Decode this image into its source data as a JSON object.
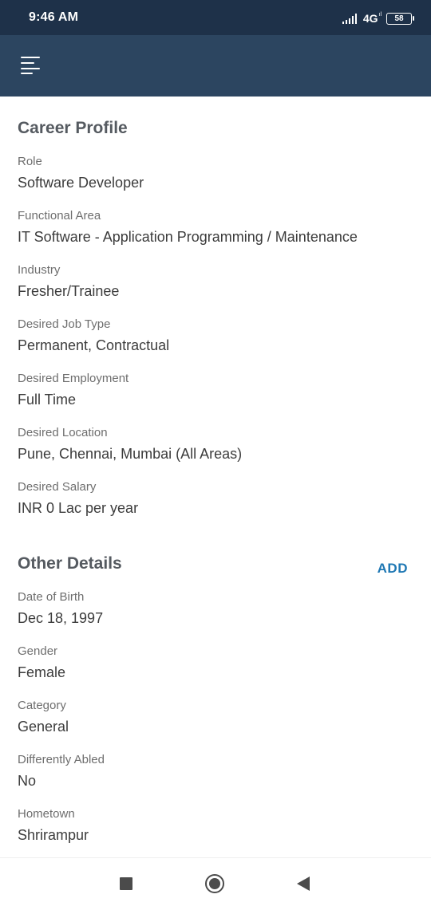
{
  "status_bar": {
    "time": "9:46 AM",
    "network": "4G",
    "battery": "58"
  },
  "app_bar": {
    "menu_icon": "hamburger-menu-icon"
  },
  "career_profile": {
    "title": "Career Profile",
    "fields": [
      {
        "label": "Role",
        "value": "Software Developer"
      },
      {
        "label": "Functional Area",
        "value": "IT Software - Application Programming / Maintenance"
      },
      {
        "label": "Industry",
        "value": "Fresher/Trainee"
      },
      {
        "label": "Desired Job Type",
        "value": "Permanent, Contractual"
      },
      {
        "label": "Desired Employment",
        "value": "Full Time"
      },
      {
        "label": "Desired Location",
        "value": "Pune, Chennai, Mumbai (All Areas)"
      },
      {
        "label": "Desired Salary",
        "value": "INR 0 Lac per year"
      }
    ]
  },
  "other_details": {
    "title": "Other Details",
    "add_label": "ADD",
    "fields": [
      {
        "label": "Date of Birth",
        "value": "Dec 18, 1997"
      },
      {
        "label": "Gender",
        "value": "Female"
      },
      {
        "label": "Category",
        "value": "General"
      },
      {
        "label": "Differently Abled",
        "value": "No"
      },
      {
        "label": "Hometown",
        "value": "Shrirampur"
      }
    ]
  },
  "nav_bar": {
    "buttons": [
      "recents-square-icon",
      "home-circle-icon",
      "back-triangle-icon"
    ]
  },
  "colors": {
    "status_bar_bg": "#1e3149",
    "app_bar_bg": "#2c4560",
    "accent": "#1f78b4"
  }
}
